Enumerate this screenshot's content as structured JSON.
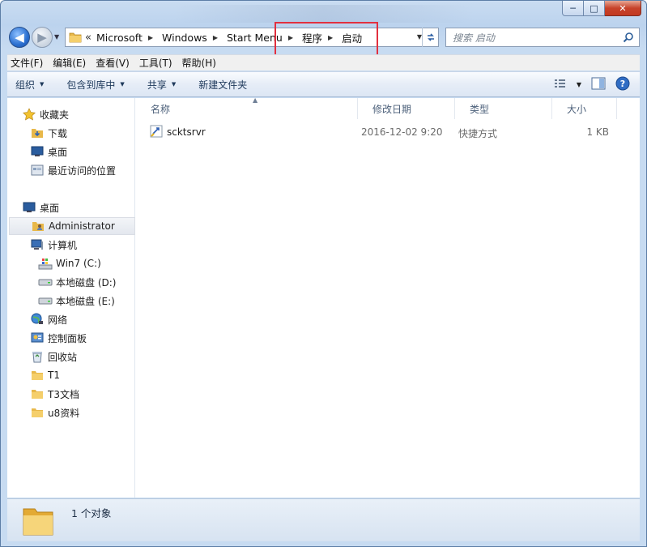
{
  "window": {
    "caption": {
      "minimize": "─",
      "maximize": "□",
      "close": "✕"
    }
  },
  "navigation": {
    "back_symbol": "◀",
    "forward_symbol": "▶",
    "chevrons": "«",
    "breadcrumb": [
      "Microsoft",
      "Windows",
      "Start Menu",
      "程序",
      "启动"
    ],
    "search_placeholder": "搜索 启动"
  },
  "menu": [
    "文件(F)",
    "编辑(E)",
    "查看(V)",
    "工具(T)",
    "帮助(H)"
  ],
  "commands": [
    "组织",
    "包含到库中",
    "共享",
    "新建文件夹"
  ],
  "nav_pane": {
    "favorites": {
      "label": "收藏夹",
      "items": [
        "下载",
        "桌面",
        "最近访问的位置"
      ]
    },
    "desktop": {
      "label": "桌面",
      "items": [
        "Administrator",
        "计算机",
        "Win7 (C:)",
        "本地磁盘 (D:)",
        "本地磁盘 (E:)",
        "网络",
        "控制面板",
        "回收站",
        "T1",
        "T3文档",
        "u8资料"
      ]
    }
  },
  "columns": [
    "名称",
    "修改日期",
    "类型",
    "大小"
  ],
  "files": [
    {
      "name": "scktsrvr",
      "date": "2016-12-02 9:20",
      "type": "快捷方式",
      "size": "1 KB"
    }
  ],
  "status": {
    "text": "1 个对象"
  },
  "colors": {
    "highlight": "#e2303f",
    "accent": "#2a6fd0"
  }
}
